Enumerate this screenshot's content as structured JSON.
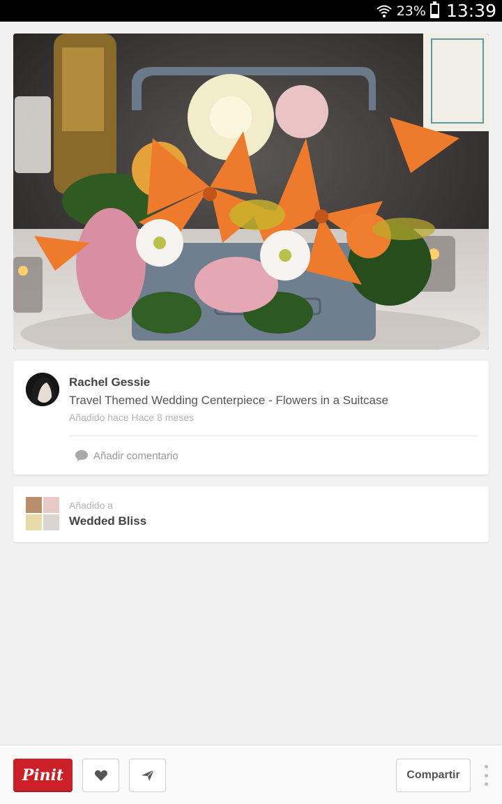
{
  "status_bar": {
    "battery_percent": "23%",
    "battery_level": 0.23,
    "time": "13:39",
    "icons": [
      "wifi-icon",
      "battery-icon"
    ]
  },
  "pin": {
    "image_icon": "flower-centerpiece-photo",
    "pinner_name": "Rachel Gessie",
    "description": "Travel Themed Wedding Centerpiece - Flowers in a Suitcase",
    "added_time": "Añadido hace Hace 8 meses",
    "comment_label": "Añadir comentario",
    "comment_icon": "speech-bubble-icon"
  },
  "board": {
    "added_label": "Añadido a",
    "name": "Wedded Bliss"
  },
  "actions": {
    "pinit_label": "Pinit",
    "like_icon": "heart-icon",
    "send_icon": "send-icon",
    "share_label": "Compartir",
    "more_icon": "more-vertical-icon"
  },
  "colors": {
    "pinit_red": "#cb2027",
    "background": "#f1f1f1"
  }
}
